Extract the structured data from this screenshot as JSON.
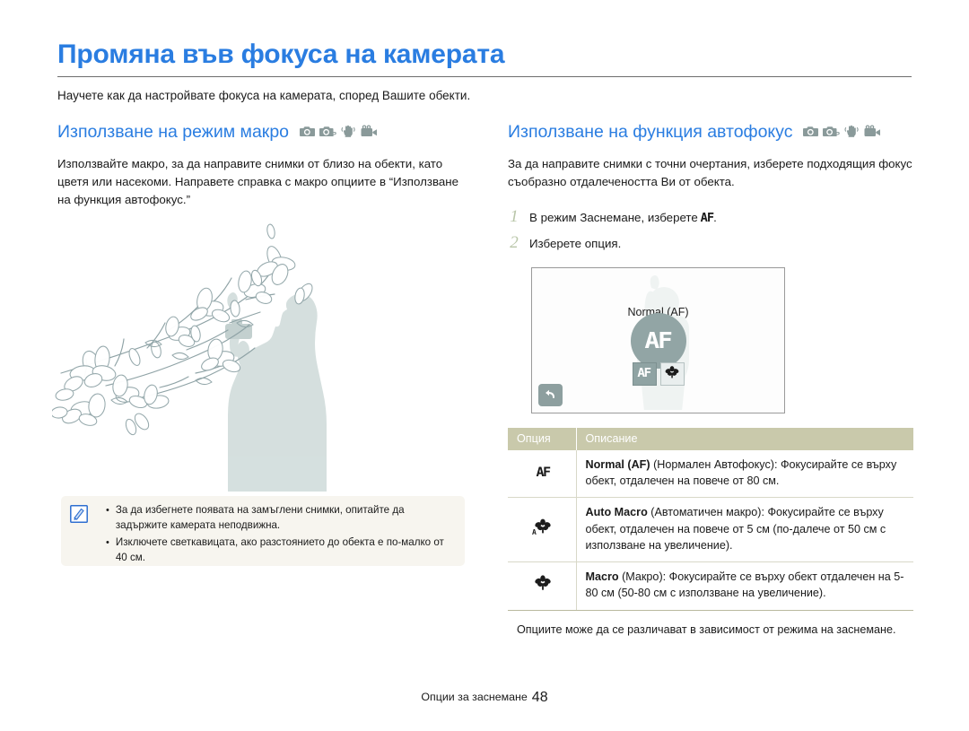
{
  "document": {
    "title": "Промяна във фокуса на камерата",
    "intro": "Научете как да настройвате фокуса на камерата, според Вашите обекти.",
    "accent_color": "#2a7de1",
    "footer_label": "Опции за заснемане",
    "footer_page": "48"
  },
  "mode_icons": [
    {
      "name": "camera-icon",
      "label": "camera"
    },
    {
      "name": "camera-program-icon",
      "label": "camera-p"
    },
    {
      "name": "anti-shake-icon",
      "label": "hand-shake"
    },
    {
      "name": "video-camera-icon",
      "label": "video"
    }
  ],
  "left_section": {
    "heading": "Използване на режим макро",
    "body": "Използвайте макро, за да направите снимки от близо на обекти, като цветя или насекоми. Направете справка с макро опциите в “Използване на функция автофокус.”",
    "illustration_name": "magnolia-branch-photographer-illustration"
  },
  "note_box": {
    "icon": "note-pencil-icon",
    "items": [
      "За да избегнете появата на замъглени снимки, опитайте да задържите камерата неподвижна.",
      "Изключете светкавицата, ако разстоянието до обекта е по-малко от 40 см."
    ],
    "background": "#f7f5ef"
  },
  "right_section": {
    "heading": "Използване на функция автофокус",
    "body": "За да направите снимки с точни очертания, изберете подходящия фокус съобразно отдалечеността Ви от обекта.",
    "steps": [
      {
        "num": "1",
        "text_before": "В режим Заснемане, изберете ",
        "glyph": "AF",
        "text_after": "."
      },
      {
        "num": "2",
        "text_before": "Изберете опция.",
        "glyph": "",
        "text_after": ""
      }
    ],
    "lcd": {
      "label": "Normal (AF)",
      "center_glyph": "AF",
      "option_buttons": [
        {
          "name": "af-option-button",
          "glyph": "AF",
          "selected": true
        },
        {
          "name": "macro-option-button",
          "glyph": "flower",
          "selected": false
        }
      ],
      "back_button_glyph": "↰"
    },
    "table": {
      "headers": [
        "Опция",
        "Описание"
      ],
      "rows": [
        {
          "icon": "af-icon",
          "icon_glyph": "AF",
          "name": "Normal (AF)",
          "description": " (Нормален Автофокус): Фокусирайте се върху обект, отдалечен на повече от 80 см."
        },
        {
          "icon": "auto-macro-icon",
          "icon_glyph": "flower-a",
          "name": "Auto Macro",
          "description": " (Автоматичен макро): Фокусирайте се върху обект, отдалечен на повече от 5 см (по-далече от 50 см с използване на увеличение)."
        },
        {
          "icon": "macro-icon",
          "icon_glyph": "flower",
          "name": "Macro",
          "description": " (Макро): Фокусирайте се върху обект отдалечен на 5-80 см (50-80 см с използване на увеличение)."
        }
      ],
      "header_background": "#c9c9ab"
    },
    "table_note": "Опциите може да се различават в зависимост от режима на заснемане."
  }
}
